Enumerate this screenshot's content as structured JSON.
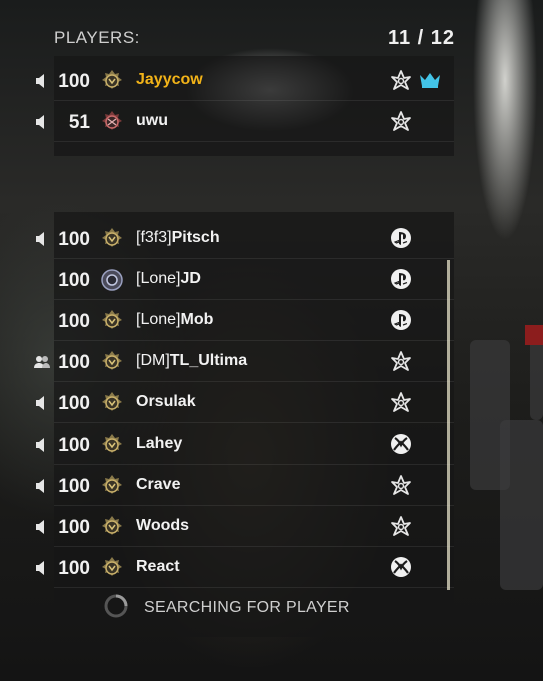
{
  "header": {
    "players_label": "PLAYERS:",
    "player_count": "11 / 12"
  },
  "colors": {
    "host_name": "#f2b318",
    "crown": "#43c4e8",
    "panel": "rgba(22,22,22,0.72)"
  },
  "party_top": [
    {
      "score": "100",
      "tag": "",
      "name": "Jayycow",
      "voice": "speaker-icon",
      "platform": "battlenet-icon",
      "host": true
    },
    {
      "score": "51",
      "tag": "",
      "name": "uwu",
      "voice": "speaker-icon",
      "platform": "battlenet-icon",
      "host": false
    }
  ],
  "players": [
    {
      "score": "100",
      "tag": "[f3f3]",
      "name": "Pitsch",
      "voice": "speaker-icon",
      "platform": "playstation-icon"
    },
    {
      "score": "100",
      "tag": "[Lone]",
      "name": "JD",
      "voice": "",
      "platform": "playstation-icon"
    },
    {
      "score": "100",
      "tag": "[Lone]",
      "name": "Mob",
      "voice": "",
      "platform": "playstation-icon"
    },
    {
      "score": "100",
      "tag": "[DM]",
      "name": "TL_Ultima",
      "voice": "party-icon",
      "platform": "battlenet-icon"
    },
    {
      "score": "100",
      "tag": "",
      "name": "Orsulak",
      "voice": "speaker-icon",
      "platform": "battlenet-icon"
    },
    {
      "score": "100",
      "tag": "",
      "name": "Lahey",
      "voice": "speaker-icon",
      "platform": "xbox-icon"
    },
    {
      "score": "100",
      "tag": "",
      "name": "Crave",
      "voice": "speaker-icon",
      "platform": "battlenet-icon"
    },
    {
      "score": "100",
      "tag": "",
      "name": "Woods",
      "voice": "speaker-icon",
      "platform": "battlenet-icon"
    },
    {
      "score": "100",
      "tag": "",
      "name": "React",
      "voice": "speaker-icon",
      "platform": "xbox-icon"
    }
  ],
  "search": {
    "text": "SEARCHING FOR PLAYER",
    "icon": "loading-spinner-icon"
  }
}
